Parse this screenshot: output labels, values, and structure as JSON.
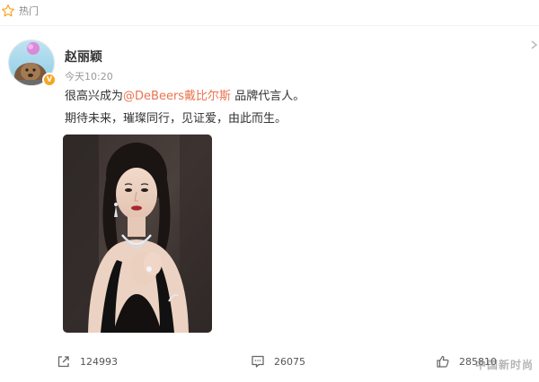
{
  "header": {
    "hot_label": "热门",
    "icon": "star-icon"
  },
  "post": {
    "author": {
      "name": "赵丽颖",
      "verified_badge": "V",
      "avatar": "avatar-image"
    },
    "timestamp": "今天10:20",
    "text": {
      "line1_prefix": "很高兴成为",
      "mention": "@DeBeers戴比尔斯",
      "line1_suffix": " 品牌代言人。",
      "line2": "期待未来，璀璨同行，见证爱，由此而生。"
    },
    "image": {
      "description_icon": "photo-portrait"
    }
  },
  "actions": {
    "repost_count": "124993",
    "comment_count": "26075",
    "like_count": "285810"
  },
  "watermark": "中国新时尚",
  "colors": {
    "mention": "#eb7350",
    "star": "#f5a623",
    "verified": "#f5a623"
  }
}
